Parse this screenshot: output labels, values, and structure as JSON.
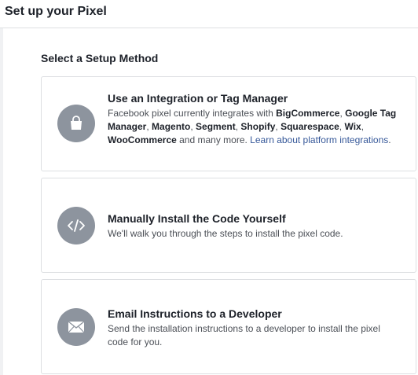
{
  "header": {
    "title": "Set up your Pixel"
  },
  "section": {
    "title": "Select a Setup Method"
  },
  "options": [
    {
      "title": "Use an Integration or Tag Manager",
      "desc_intro": "Facebook pixel currently integrates with ",
      "partners": [
        "BigCommerce",
        "Google Tag Manager",
        "Magento",
        "Segment",
        "Shopify",
        "Squarespace",
        "Wix",
        "WooCommerce"
      ],
      "desc_outro": " and many more. ",
      "link": "Learn about platform integrations",
      "desc_end": ".",
      "icon": "shopping-bag-icon"
    },
    {
      "title": "Manually Install the Code Yourself",
      "desc": "We'll walk you through the steps to install the pixel code.",
      "icon": "code-icon"
    },
    {
      "title": "Email Instructions to a Developer",
      "desc": "Send the installation instructions to a developer to install the pixel code for you.",
      "icon": "envelope-icon"
    }
  ],
  "colors": {
    "icon_bg": "#8d949e",
    "link": "#365899",
    "border": "#dddfe2",
    "text": "#1d2129"
  }
}
